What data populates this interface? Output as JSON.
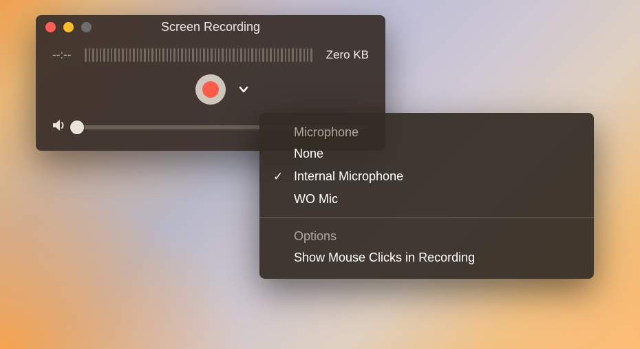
{
  "window": {
    "title": "Screen Recording"
  },
  "info": {
    "timecode": "--:--",
    "filesize": "Zero KB"
  },
  "menu": {
    "microphone_header": "Microphone",
    "microphone_options": {
      "none": "None",
      "internal": "Internal Microphone",
      "womic": "WO Mic"
    },
    "microphone_selected": "internal",
    "options_header": "Options",
    "options": {
      "show_clicks": "Show Mouse Clicks in Recording"
    }
  },
  "volume": {
    "value": 0
  }
}
